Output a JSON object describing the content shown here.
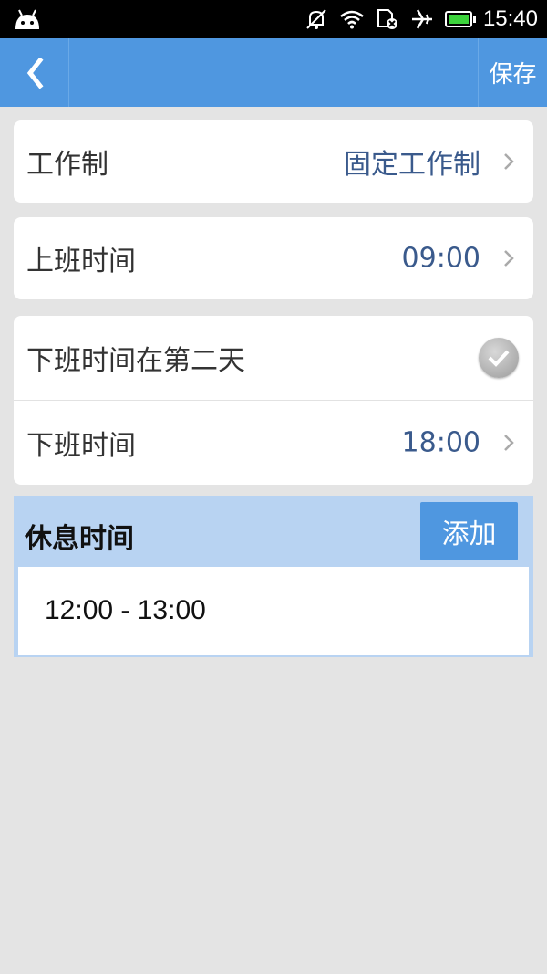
{
  "status_bar": {
    "time": "15:40",
    "icons": [
      "android-icon",
      "mute-icon",
      "wifi-icon",
      "sim-off-icon",
      "airplane-icon",
      "battery-icon"
    ],
    "battery_color": "#3cd33c"
  },
  "titlebar": {
    "back_icon": "chevron-left-icon",
    "save_label": "保存",
    "color": "#4f97e0"
  },
  "settings": {
    "work_schedule": {
      "label": "工作制",
      "value": "固定工作制"
    },
    "start_time": {
      "label": "上班时间",
      "value": "09:00"
    },
    "next_day": {
      "label": "下班时间在第二天",
      "checked": true
    },
    "end_time": {
      "label": "下班时间",
      "value": "18:00"
    }
  },
  "break_section": {
    "title": "休息时间",
    "add_label": "添加",
    "items": [
      "12:00 - 13:00"
    ]
  }
}
